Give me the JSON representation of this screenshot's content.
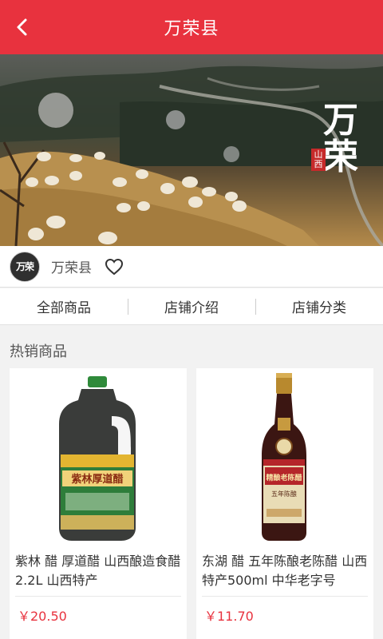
{
  "header": {
    "title": "万荣县",
    "back_icon": "chevron-left-icon",
    "bg_color": "#e8323e"
  },
  "banner": {
    "calligraphy_main": "万荣",
    "seal_text": "山西"
  },
  "shop": {
    "avatar_text": "万荣",
    "name": "万荣县",
    "favorite_icon": "heart-outline-icon"
  },
  "tabs": [
    {
      "label": "全部商品"
    },
    {
      "label": "店铺介绍"
    },
    {
      "label": "店铺分类"
    }
  ],
  "section": {
    "title": "热销商品"
  },
  "products": [
    {
      "name": "紫林 醋 厚道醋 山西酿造食醋 2.2L 山西特产",
      "price": "￥20.50",
      "label_text": "紫林厚道醋"
    },
    {
      "name": "东湖 醋 五年陈酿老陈醋 山西特产500ml 中华老字号",
      "price": "￥11.70",
      "label_text": "精酿老陈醋",
      "sub_label": "五年陈酿"
    }
  ],
  "colors": {
    "accent": "#e8323e",
    "background": "#f2f2f2"
  }
}
